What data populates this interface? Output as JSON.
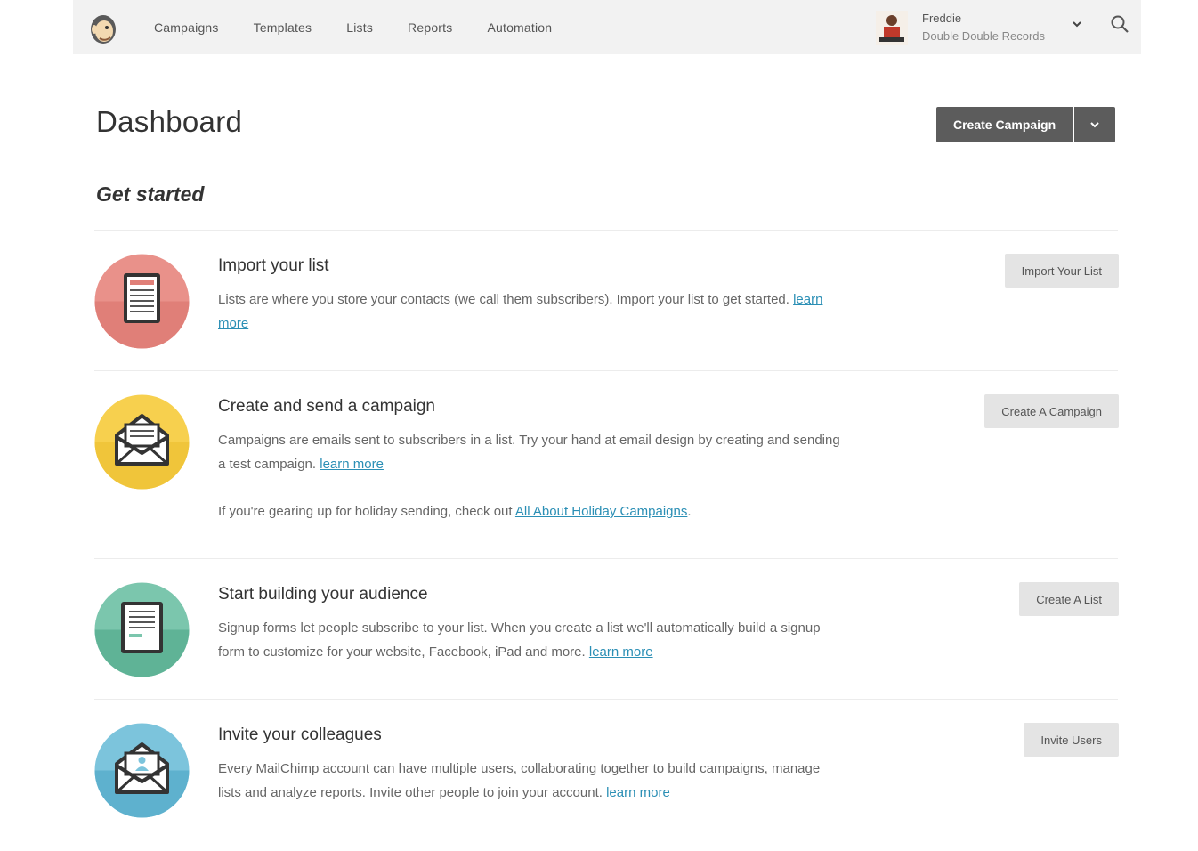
{
  "nav": {
    "items": [
      "Campaigns",
      "Templates",
      "Lists",
      "Reports",
      "Automation"
    ]
  },
  "user": {
    "name": "Freddie",
    "org": "Double Double Records"
  },
  "page": {
    "title": "Dashboard",
    "subtitle": "Get started",
    "primary_button": "Create Campaign"
  },
  "rows": [
    {
      "title": "Import your list",
      "desc": "Lists are where you store your contacts (we call them subscribers). Import your list to get started.",
      "link": "learn more",
      "button": "Import Your List"
    },
    {
      "title": "Create and send a campaign",
      "desc": "Campaigns are emails sent to subscribers in a list. Try your hand at email design by creating and sending a test campaign.",
      "link": "learn more",
      "extra_prefix": "If you're gearing up for holiday sending, check out",
      "extra_link": "All About Holiday Campaigns",
      "extra_suffix": ".",
      "button": "Create A Campaign"
    },
    {
      "title": "Start building your audience",
      "desc": "Signup forms let people subscribe to your list. When you create a list we'll automatically build a signup form to customize for your website, Facebook, iPad and more.",
      "link": "learn more",
      "button": "Create A List"
    },
    {
      "title": "Invite your colleagues",
      "desc": "Every MailChimp account can have multiple users, collaborating together to build campaigns, manage lists and analyze reports. Invite other people to join your account.",
      "link": "learn more",
      "button": "Invite Users"
    }
  ],
  "colors": {
    "accent_link": "#2b8fb5",
    "icon_red": "#e9918a",
    "icon_yellow": "#f7d04e",
    "icon_teal": "#7bc6ad",
    "icon_blue": "#7cc4dc",
    "button_dark": "#5c5c5c"
  },
  "icons": {
    "logo": "freddie-logo",
    "avatar": "user-avatar",
    "chevron": "chevron-down-icon",
    "search": "search-icon"
  }
}
